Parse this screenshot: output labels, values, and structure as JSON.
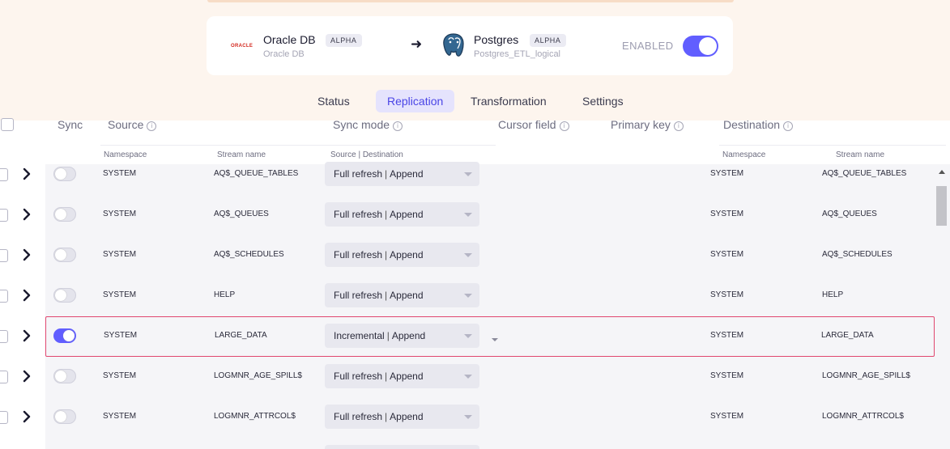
{
  "connection": {
    "source": {
      "name": "Oracle DB",
      "subtitle": "Oracle DB",
      "badge": "ALPHA",
      "logo_text": "ORACLE"
    },
    "destination": {
      "name": "Postgres",
      "subtitle": "Postgres_ETL_logical",
      "badge": "ALPHA"
    },
    "status_label": "ENABLED",
    "enabled": true
  },
  "tabs": [
    {
      "label": "Status",
      "active": false
    },
    {
      "label": "Replication",
      "active": true
    },
    {
      "label": "Transformation",
      "active": false
    },
    {
      "label": "Settings",
      "active": false
    }
  ],
  "table": {
    "headers": {
      "sync": "Sync",
      "source": "Source",
      "sync_mode": "Sync mode",
      "cursor_field": "Cursor field",
      "primary_key": "Primary key",
      "destination": "Destination"
    },
    "subheaders": {
      "namespace": "Namespace",
      "stream_name": "Stream name",
      "source_destination": "Source | Destination",
      "dest_namespace": "Namespace",
      "dest_stream_name": "Stream name"
    },
    "rows": [
      {
        "sync": false,
        "namespace": "SYSTEM",
        "stream": "AQ$_QUEUE_TABLES",
        "mode_source": "Full refresh",
        "mode_dest": "Append",
        "dest_namespace": "SYSTEM",
        "dest_stream": "AQ$_QUEUE_TABLES"
      },
      {
        "sync": false,
        "namespace": "SYSTEM",
        "stream": "AQ$_QUEUES",
        "mode_source": "Full refresh",
        "mode_dest": "Append",
        "dest_namespace": "SYSTEM",
        "dest_stream": "AQ$_QUEUES"
      },
      {
        "sync": false,
        "namespace": "SYSTEM",
        "stream": "AQ$_SCHEDULES",
        "mode_source": "Full refresh",
        "mode_dest": "Append",
        "dest_namespace": "SYSTEM",
        "dest_stream": "AQ$_SCHEDULES"
      },
      {
        "sync": false,
        "namespace": "SYSTEM",
        "stream": "HELP",
        "mode_source": "Full refresh",
        "mode_dest": "Append",
        "dest_namespace": "SYSTEM",
        "dest_stream": "HELP"
      },
      {
        "sync": true,
        "namespace": "SYSTEM",
        "stream": "LARGE_DATA",
        "mode_source": "Incremental",
        "mode_dest": "Append",
        "dest_namespace": "SYSTEM",
        "dest_stream": "LARGE_DATA"
      },
      {
        "sync": false,
        "namespace": "SYSTEM",
        "stream": "LOGMNR_AGE_SPILL$",
        "mode_source": "Full refresh",
        "mode_dest": "Append",
        "dest_namespace": "SYSTEM",
        "dest_stream": "LOGMNR_AGE_SPILL$"
      },
      {
        "sync": false,
        "namespace": "SYSTEM",
        "stream": "LOGMNR_ATTRCOL$",
        "mode_source": "Full refresh",
        "mode_dest": "Append",
        "dest_namespace": "SYSTEM",
        "dest_stream": "LOGMNR_ATTRCOL$"
      }
    ]
  },
  "icons": {
    "expand": "chevron-right-icon",
    "info": "info-icon",
    "destination_logo": "postgres-elephant-icon"
  },
  "colors": {
    "accent": "#615eff",
    "selected_row_border": "#e0476f",
    "header_band": "#fdf5ee"
  }
}
